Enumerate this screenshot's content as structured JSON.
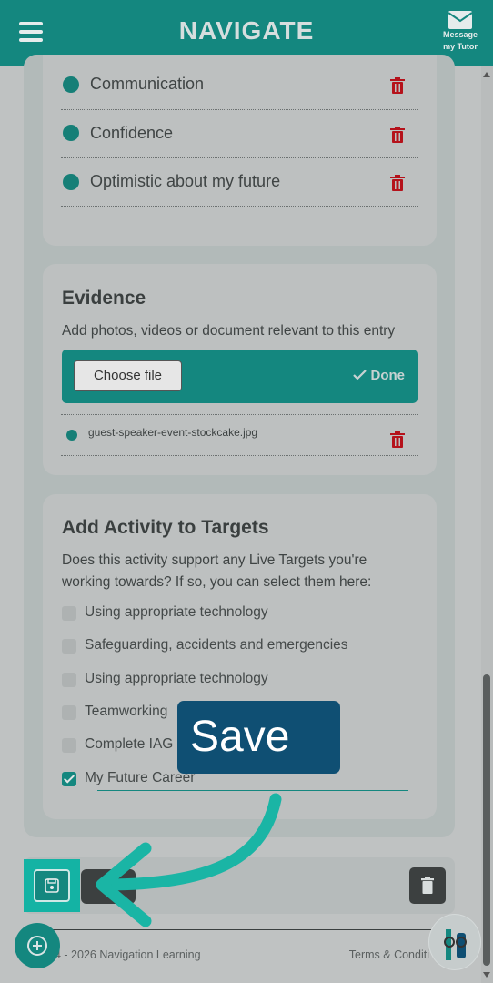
{
  "header": {
    "brand": "NAVIGATE",
    "message_label_1": "Message",
    "message_label_2": "my Tutor"
  },
  "skills": {
    "items": [
      {
        "label": "Communication"
      },
      {
        "label": "Confidence"
      },
      {
        "label": "Optimistic about my future"
      }
    ]
  },
  "evidence": {
    "title": "Evidence",
    "subtitle": "Add photos, videos or document relevant to this entry",
    "choose_file_label": "Choose file",
    "done_label": "Done",
    "file_name": "guest-speaker-event-stockcake.jpg"
  },
  "targets": {
    "title": "Add Activity to Targets",
    "subtitle": "Does this activity support any Live Targets you're working towards? If so, you can select them here:",
    "items": [
      {
        "label": "Using appropriate technology",
        "checked": false
      },
      {
        "label": "Safeguarding, accidents and emergencies",
        "checked": false
      },
      {
        "label": "Using appropriate technology",
        "checked": false
      },
      {
        "label": "Teamworking",
        "checked": false
      },
      {
        "label": "Complete IAG",
        "checked": false
      },
      {
        "label": "My Future Career",
        "checked": true
      }
    ]
  },
  "tooltip": {
    "text": "Save"
  },
  "footer": {
    "copyright": "4 - 2026 Navigation Learning",
    "terms": "Terms & Conditi"
  },
  "colors": {
    "primary_teal": "#14877f",
    "highlight_teal": "#14b3a4",
    "tooltip_blue": "#0f4f73",
    "delete_red": "#b5121b"
  },
  "icons": {
    "menu": "hamburger-icon",
    "message": "envelope-icon",
    "delete": "trash-icon",
    "done": "check-icon",
    "save": "floppy-disk-icon",
    "add": "plus-circle-icon"
  }
}
